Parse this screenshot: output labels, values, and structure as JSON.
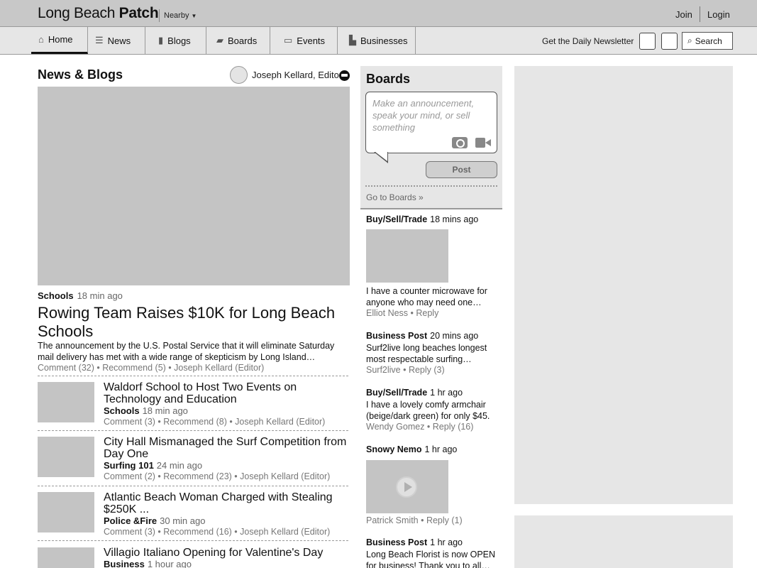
{
  "header": {
    "brand_regular": "Long Beach",
    "brand_bold": "Patch",
    "nearby": "Nearby",
    "join": "Join",
    "login": "Login"
  },
  "nav": {
    "items": [
      {
        "label": "Home",
        "icon": "home-icon"
      },
      {
        "label": "News",
        "icon": "menu-icon"
      },
      {
        "label": "Blogs",
        "icon": "book-icon"
      },
      {
        "label": "Boards",
        "icon": "chat-icon"
      },
      {
        "label": "Events",
        "icon": "calendar-icon"
      },
      {
        "label": "Businesses",
        "icon": "store-icon"
      }
    ],
    "newsletter": "Get the Daily Newsletter",
    "search": "Search"
  },
  "news": {
    "title": "News & Blogs",
    "editor": "Joseph Kellard, Editor",
    "hero": {
      "category": "Schools",
      "time": "18 min ago",
      "title": "Rowing Team Raises $10K for Long Beach Schools",
      "summary": "The announcement by the U.S. Postal Service that it will eliminate Saturday mail delivery has met with a wide range of skepticism by Long Island…",
      "meta": "Comment (32) • Recommend (5) • Joseph Kellard (Editor)"
    },
    "articles": [
      {
        "title": "Waldorf School to Host Two Events on Technology and Education",
        "category": "Schools",
        "time": "18 min ago",
        "meta": "Comment (3) • Recommend (8) • Joseph Kellard (Editor)"
      },
      {
        "title": "City Hall Mismanaged the Surf Competition from Day One",
        "category": "Surfing 101",
        "time": "24 min ago",
        "meta": "Comment (2) • Recommend (23) • Joseph Kellard (Editor)"
      },
      {
        "title": "Atlantic Beach Woman Charged with Stealing $250K ...",
        "category": "Police &Fire",
        "time": "30 min ago",
        "meta": "Comment (3) • Recommend (16) • Joseph Kellard (Editor)"
      },
      {
        "title": "Villagio Italiano Opening for Valentine's Day",
        "category": "Business",
        "time": "1 hour ago",
        "meta": ""
      }
    ]
  },
  "boards": {
    "title": "Boards",
    "placeholder": "Make an announcement, speak your mind, or sell something",
    "post": "Post",
    "goto": "Go to Boards »",
    "posts": [
      {
        "type": "Buy/Sell/Trade",
        "time": "18 mins ago",
        "text": "I have a counter microwave for anyone who may need one…",
        "meta": "Elliot Ness • Reply"
      },
      {
        "type": "Business Post",
        "time": "20 mins ago",
        "text": "Surf2live long beaches longest most respectable surfing…",
        "meta": "Surf2live • Reply (3)"
      },
      {
        "type": "Buy/Sell/Trade",
        "time": "1 hr ago",
        "text": "I have a lovely comfy armchair (beige/dark green) for only $45.",
        "meta": "Wendy Gomez • Reply (16)"
      },
      {
        "type": "Snowy Nemo",
        "time": "1 hr ago",
        "text": "",
        "meta": "Patrick Smith • Reply (1)"
      },
      {
        "type": "Business Post",
        "time": "1 hr ago",
        "text": "Long Beach Florist is now OPEN for business! Thank you to all…",
        "meta": ""
      }
    ]
  }
}
